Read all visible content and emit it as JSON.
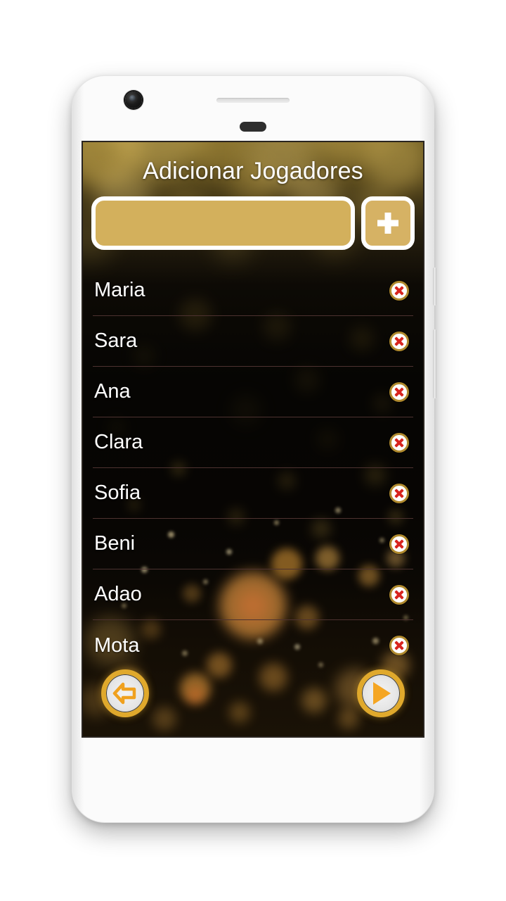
{
  "app": {
    "title": "Adicionar Jogadores"
  },
  "add_form": {
    "input_value": "",
    "input_placeholder": "",
    "add_button_label": "+"
  },
  "players": [
    {
      "name": "Maria",
      "delete_label": "x"
    },
    {
      "name": "Sara",
      "delete_label": "x"
    },
    {
      "name": "Ana",
      "delete_label": "x"
    },
    {
      "name": "Clara",
      "delete_label": "x"
    },
    {
      "name": "Sofia",
      "delete_label": "x"
    },
    {
      "name": "Beni",
      "delete_label": "x"
    },
    {
      "name": "Adao",
      "delete_label": "x"
    },
    {
      "name": "Mota",
      "delete_label": "x"
    }
  ],
  "bottom_nav": {
    "back_icon": "arrow-left-icon",
    "play_icon": "play-icon"
  },
  "device": {
    "camera_icon": "camera-icon",
    "speaker_icon": "speaker-grille-icon",
    "sensor_icon": "proximity-sensor-icon"
  },
  "colors": {
    "accent_gold": "#e0a92c",
    "input_fill": "#d3b05c",
    "delete_red": "#d8251f",
    "play_arrow": "#f5a623",
    "screen_bg": "#0a0806",
    "text_white": "#ffffff",
    "separator": "#4d3230"
  }
}
